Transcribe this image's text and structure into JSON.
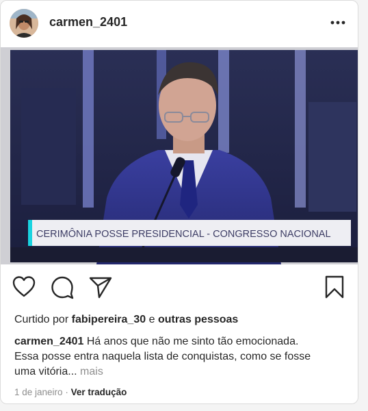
{
  "post": {
    "username": "carmen_2401",
    "more_icon": "ellipsis-icon",
    "media": {
      "lower_third_text": "CERIMÔNIA POSSE PRESIDENCIAL - CONGRESSO NACIONAL",
      "accent_color": "#19d3e0"
    },
    "actions": {
      "like_icon": "heart-icon",
      "comment_icon": "comment-icon",
      "share_icon": "share-icon",
      "save_icon": "bookmark-icon"
    },
    "likes": {
      "prefix": "Curtido por",
      "user": "fabipereira_30",
      "joiner": "e",
      "others": "outras pessoas"
    },
    "caption": {
      "username": "carmen_2401",
      "text": "Há anos que não me sinto tão emocionada. Essa posse entra naquela lista de conquistas, como se fosse uma vitória...",
      "more_label": "mais"
    },
    "date": "1 de janeiro",
    "separator": "·",
    "translate_label": "Ver tradução"
  }
}
